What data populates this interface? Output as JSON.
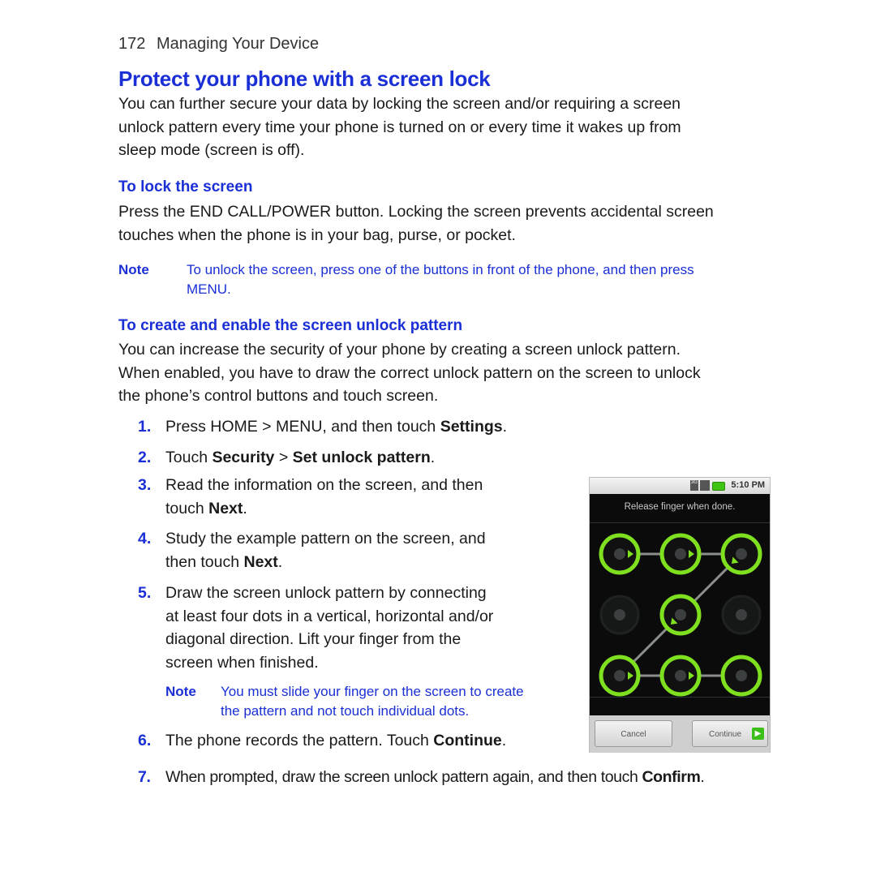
{
  "running_head": {
    "page_number": "172",
    "section": "Managing Your Device"
  },
  "title": "Protect your phone with a screen lock",
  "intro": [
    "You can further secure your data by locking the screen and/or requiring a screen",
    "unlock pattern every time your phone is turned on or every time it wakes up from",
    "sleep mode (screen is off)."
  ],
  "lock_section": {
    "heading": "To lock the screen",
    "body": [
      "Press the END CALL/POWER button. Locking the screen prevents accidental screen",
      "touches when the phone is in your bag, purse, or pocket."
    ],
    "note_label": "Note",
    "note_text": [
      "To unlock the screen, press one of the buttons in front of the phone, and then press",
      "MENU."
    ]
  },
  "pattern_section": {
    "heading": "To create and enable the screen unlock pattern",
    "body": [
      "You can increase the security of your phone by creating a screen unlock pattern.",
      "When enabled, you have to draw the correct unlock pattern on the screen to unlock",
      "the phone’s control buttons and touch screen."
    ],
    "steps": [
      {
        "num": "1.",
        "pre": "Press HOME > MENU, and then touch ",
        "bold": "Settings",
        "post": "."
      },
      {
        "num": "2.",
        "pre": "Touch ",
        "bold": "Security",
        "mid": " > ",
        "bold2": "Set unlock pattern",
        "post": "."
      },
      {
        "num": "3.",
        "line1": "Read the information on the screen, and then",
        "pre": "touch ",
        "bold": "Next",
        "post": "."
      },
      {
        "num": "4.",
        "line1": "Study the example pattern on the screen, and",
        "pre": "then touch ",
        "bold": "Next",
        "post": "."
      },
      {
        "num": "5.",
        "lines": [
          "Draw the screen unlock pattern by connecting",
          "at least four dots in a vertical, horizontal and/or",
          "diagonal direction. Lift your finger from the",
          "screen when finished."
        ]
      },
      {
        "num": "6.",
        "pre": "The phone records the pattern. Touch ",
        "bold": "Continue",
        "post": "."
      },
      {
        "num": "7.",
        "pre": "When prompted, draw the screen unlock pattern again, and then touch ",
        "bold": "Confirm",
        "post": "."
      }
    ],
    "step5_note_label": "Note",
    "step5_note_text": [
      "You must slide your finger on the screen to create",
      "the pattern and not touch individual dots."
    ]
  },
  "phone_screen": {
    "status_time": "5:10 PM",
    "status_icons": [
      "3g-icon",
      "signal-icon",
      "battery-icon"
    ],
    "network_label": "3G",
    "prompt": "Release finger when done.",
    "pattern_path": [
      1,
      2,
      3,
      5,
      7,
      8,
      9
    ],
    "active_color": "#7fe01f",
    "cancel_label": "Cancel",
    "continue_label": "Continue"
  }
}
